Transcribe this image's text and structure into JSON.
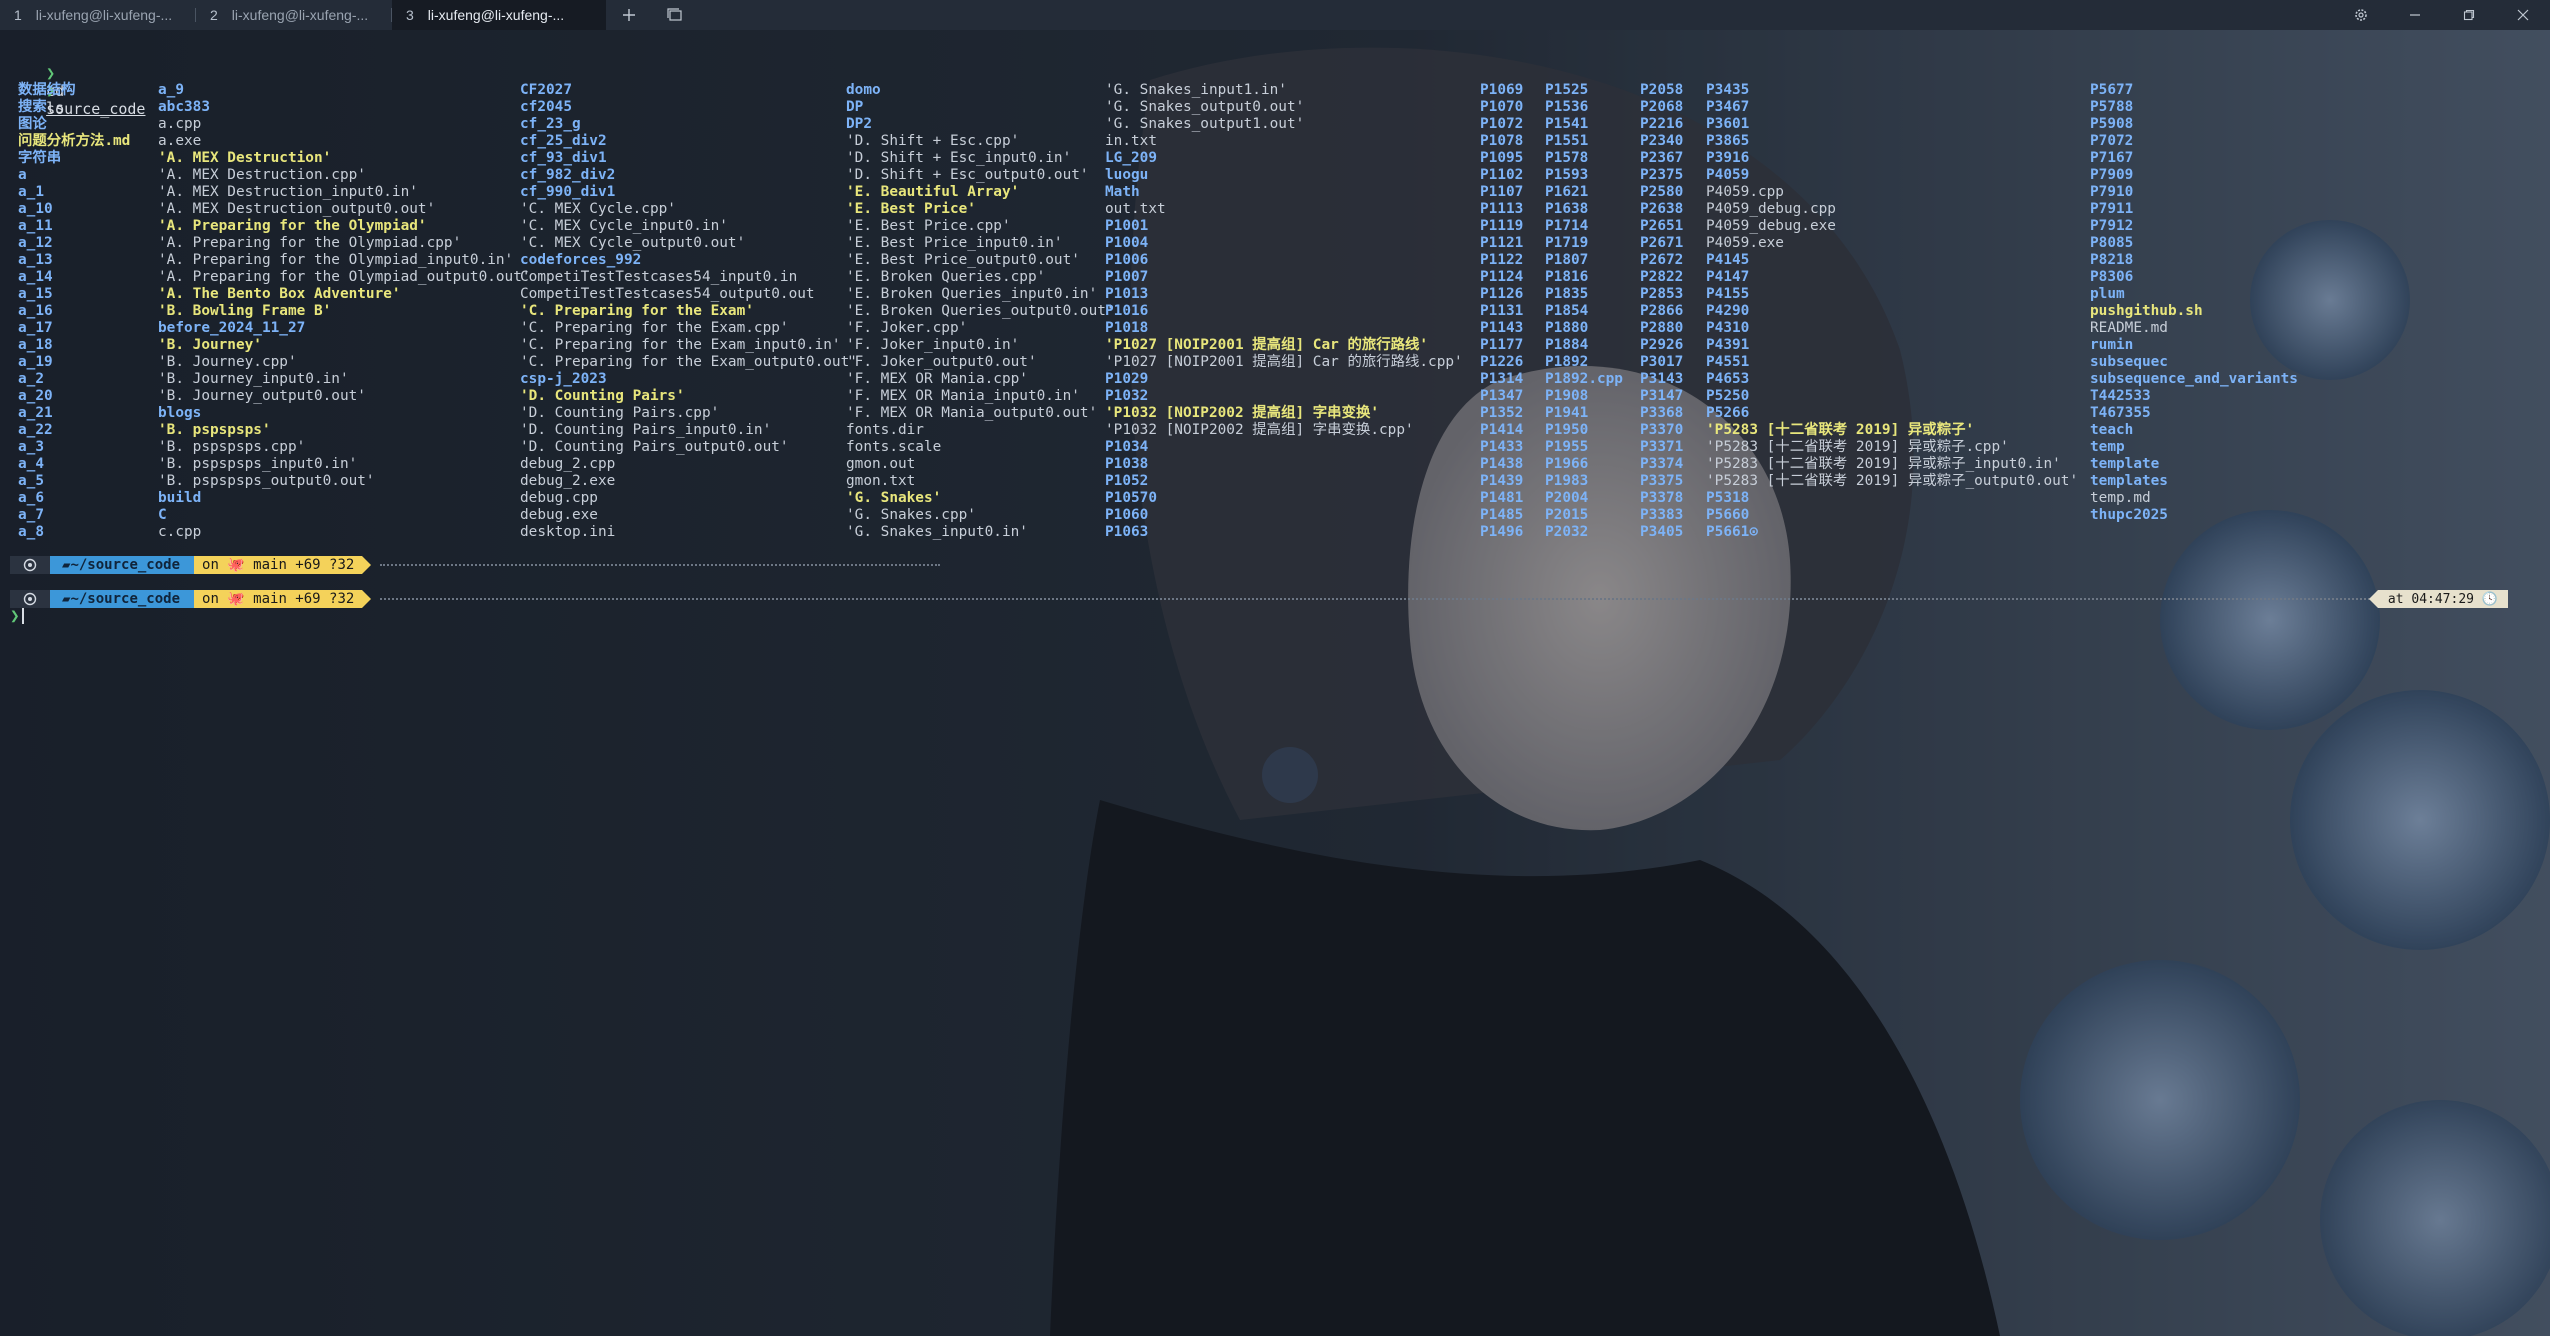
{
  "tabs": [
    {
      "num": "1",
      "label": "li-xufeng@li-xufeng-...",
      "active": false
    },
    {
      "num": "2",
      "label": "li-xufeng@li-xufeng-...",
      "active": false
    },
    {
      "num": "3",
      "label": "li-xufeng@li-xufeng-...",
      "active": true
    }
  ],
  "titlebar": {
    "new_tab_icon": "plus-icon",
    "tab_list_icon": "tab-list-icon",
    "settings_icon": "gear-icon",
    "minimize_icon": "minimize-icon",
    "maximize_icon": "maximize-icon",
    "close_icon": "close-icon"
  },
  "terminal": {
    "prompt_symbol": "❯",
    "commands": [
      {
        "cmd": "cd",
        "arg": "source_code"
      },
      {
        "cmd": "ls",
        "arg": ""
      }
    ],
    "listing_columns": [
      [
        [
          "数据结构",
          "dir"
        ],
        [
          "搜索",
          "dir"
        ],
        [
          "图论",
          "dir"
        ],
        [
          "问题分析方法.md",
          "hl"
        ],
        [
          "字符串",
          "dir"
        ],
        [
          "a",
          "dir"
        ],
        [
          "a_1",
          "dir"
        ],
        [
          "a_10",
          "dir"
        ],
        [
          "a_11",
          "dir"
        ],
        [
          "a_12",
          "dir"
        ],
        [
          "a_13",
          "dir"
        ],
        [
          "a_14",
          "dir"
        ],
        [
          "a_15",
          "dir"
        ],
        [
          "a_16",
          "dir"
        ],
        [
          "a_17",
          "dir"
        ],
        [
          "a_18",
          "dir"
        ],
        [
          "a_19",
          "dir"
        ],
        [
          "a_2",
          "dir"
        ],
        [
          "a_20",
          "dir"
        ],
        [
          "a_21",
          "dir"
        ],
        [
          "a_22",
          "dir"
        ],
        [
          "a_3",
          "dir"
        ],
        [
          "a_4",
          "dir"
        ],
        [
          "a_5",
          "dir"
        ],
        [
          "a_6",
          "dir"
        ],
        [
          "a_7",
          "dir"
        ],
        [
          "a_8",
          "dir"
        ]
      ],
      [
        [
          "a_9",
          "dir"
        ],
        [
          "abc383",
          "dir"
        ],
        [
          "a.cpp",
          "file"
        ],
        [
          "a.exe",
          "file"
        ],
        [
          "'A. MEX Destruction'",
          "hl"
        ],
        [
          "'A. MEX Destruction.cpp'",
          "file"
        ],
        [
          "'A. MEX Destruction_input0.in'",
          "file"
        ],
        [
          "'A. MEX Destruction_output0.out'",
          "file"
        ],
        [
          "'A. Preparing for the Olympiad'",
          "hl"
        ],
        [
          "'A. Preparing for the Olympiad.cpp'",
          "file"
        ],
        [
          "'A. Preparing for the Olympiad_input0.in'",
          "file"
        ],
        [
          "'A. Preparing for the Olympiad_output0.out'",
          "file"
        ],
        [
          "'A. The Bento Box Adventure'",
          "hl"
        ],
        [
          "'B. Bowling Frame B'",
          "hl"
        ],
        [
          "before_2024_11_27",
          "dir"
        ],
        [
          "'B. Journey'",
          "hl"
        ],
        [
          "'B. Journey.cpp'",
          "file"
        ],
        [
          "'B. Journey_input0.in'",
          "file"
        ],
        [
          "'B. Journey_output0.out'",
          "file"
        ],
        [
          "blogs",
          "dir"
        ],
        [
          "'B. pspspsps'",
          "hl"
        ],
        [
          "'B. pspspsps.cpp'",
          "file"
        ],
        [
          "'B. pspspsps_input0.in'",
          "file"
        ],
        [
          "'B. pspspsps_output0.out'",
          "file"
        ],
        [
          "build",
          "dir"
        ],
        [
          "C",
          "dir"
        ],
        [
          "c.cpp",
          "file"
        ]
      ],
      [
        [
          "CF2027",
          "dir"
        ],
        [
          "cf2045",
          "dir"
        ],
        [
          "cf_23_g",
          "dir"
        ],
        [
          "cf_25_div2",
          "dir"
        ],
        [
          "cf_93_div1",
          "dir"
        ],
        [
          "cf_982_div2",
          "dir"
        ],
        [
          "cf_990_div1",
          "dir"
        ],
        [
          "'C. MEX Cycle.cpp'",
          "file"
        ],
        [
          "'C. MEX Cycle_input0.in'",
          "file"
        ],
        [
          "'C. MEX Cycle_output0.out'",
          "file"
        ],
        [
          "codeforces_992",
          "dir"
        ],
        [
          "CompetiTestTestcases54_input0.in",
          "file"
        ],
        [
          "CompetiTestTestcases54_output0.out",
          "file"
        ],
        [
          "'C. Preparing for the Exam'",
          "hl"
        ],
        [
          "'C. Preparing for the Exam.cpp'",
          "file"
        ],
        [
          "'C. Preparing for the Exam_input0.in'",
          "file"
        ],
        [
          "'C. Preparing for the Exam_output0.out'",
          "file"
        ],
        [
          "csp-j_2023",
          "dir"
        ],
        [
          "'D. Counting Pairs'",
          "hl"
        ],
        [
          "'D. Counting Pairs.cpp'",
          "file"
        ],
        [
          "'D. Counting Pairs_input0.in'",
          "file"
        ],
        [
          "'D. Counting Pairs_output0.out'",
          "file"
        ],
        [
          "debug_2.cpp",
          "file"
        ],
        [
          "debug_2.exe",
          "file"
        ],
        [
          "debug.cpp",
          "file"
        ],
        [
          "debug.exe",
          "file"
        ],
        [
          "desktop.ini",
          "file"
        ]
      ],
      [
        [
          "domo",
          "dir"
        ],
        [
          "DP",
          "dir"
        ],
        [
          "DP2",
          "dir"
        ],
        [
          "'D. Shift + Esc.cpp'",
          "file"
        ],
        [
          "'D. Shift + Esc_input0.in'",
          "file"
        ],
        [
          "'D. Shift + Esc_output0.out'",
          "file"
        ],
        [
          "'E. Beautiful Array'",
          "hl"
        ],
        [
          "'E. Best Price'",
          "hl"
        ],
        [
          "'E. Best Price.cpp'",
          "file"
        ],
        [
          "'E. Best Price_input0.in'",
          "file"
        ],
        [
          "'E. Best Price_output0.out'",
          "file"
        ],
        [
          "'E. Broken Queries.cpp'",
          "file"
        ],
        [
          "'E. Broken Queries_input0.in'",
          "file"
        ],
        [
          "'E. Broken Queries_output0.out'",
          "file"
        ],
        [
          "'F. Joker.cpp'",
          "file"
        ],
        [
          "'F. Joker_input0.in'",
          "file"
        ],
        [
          "'F. Joker_output0.out'",
          "file"
        ],
        [
          "'F. MEX OR Mania.cpp'",
          "file"
        ],
        [
          "'F. MEX OR Mania_input0.in'",
          "file"
        ],
        [
          "'F. MEX OR Mania_output0.out'",
          "file"
        ],
        [
          "fonts.dir",
          "file"
        ],
        [
          "fonts.scale",
          "file"
        ],
        [
          "gmon.out",
          "file"
        ],
        [
          "gmon.txt",
          "file"
        ],
        [
          "'G. Snakes'",
          "hl"
        ],
        [
          "'G. Snakes.cpp'",
          "file"
        ],
        [
          "'G. Snakes_input0.in'",
          "file"
        ]
      ],
      [
        [
          "'G. Snakes_input1.in'",
          "file"
        ],
        [
          "'G. Snakes_output0.out'",
          "file"
        ],
        [
          "'G. Snakes_output1.out'",
          "file"
        ],
        [
          "in.txt",
          "file"
        ],
        [
          "LG_209",
          "dir"
        ],
        [
          "luogu",
          "dir"
        ],
        [
          "Math",
          "dir"
        ],
        [
          "out.txt",
          "file"
        ],
        [
          "P1001",
          "dir"
        ],
        [
          "P1004",
          "dir"
        ],
        [
          "P1006",
          "dir"
        ],
        [
          "P1007",
          "dir"
        ],
        [
          "P1013",
          "dir"
        ],
        [
          "P1016",
          "dir"
        ],
        [
          "P1018",
          "dir"
        ],
        [
          "'P1027 [NOIP2001 提高组] Car 的旅行路线'",
          "hl"
        ],
        [
          "'P1027 [NOIP2001 提高组] Car 的旅行路线.cpp'",
          "file"
        ],
        [
          "P1029",
          "dir"
        ],
        [
          "P1032",
          "dir"
        ],
        [
          "'P1032 [NOIP2002 提高组] 字串变换'",
          "hl"
        ],
        [
          "'P1032 [NOIP2002 提高组] 字串变换.cpp'",
          "file"
        ],
        [
          "P1034",
          "dir"
        ],
        [
          "P1038",
          "dir"
        ],
        [
          "P1052",
          "dir"
        ],
        [
          "P10570",
          "dir"
        ],
        [
          "P1060",
          "dir"
        ],
        [
          "P1063",
          "dir"
        ]
      ],
      [
        [
          "P1069",
          "dir"
        ],
        [
          "P1070",
          "dir"
        ],
        [
          "P1072",
          "dir"
        ],
        [
          "P1078",
          "dir"
        ],
        [
          "P1095",
          "dir"
        ],
        [
          "P1102",
          "dir"
        ],
        [
          "P1107",
          "dir"
        ],
        [
          "P1113",
          "dir"
        ],
        [
          "P1119",
          "dir"
        ],
        [
          "P1121",
          "dir"
        ],
        [
          "P1122",
          "dir"
        ],
        [
          "P1124",
          "dir"
        ],
        [
          "P1126",
          "dir"
        ],
        [
          "P1131",
          "dir"
        ],
        [
          "P1143",
          "dir"
        ],
        [
          "P1177",
          "dir"
        ],
        [
          "P1226",
          "dir"
        ],
        [
          "P1314",
          "dir"
        ],
        [
          "P1347",
          "dir"
        ],
        [
          "P1352",
          "dir"
        ],
        [
          "P1414",
          "dir"
        ],
        [
          "P1433",
          "dir"
        ],
        [
          "P1438",
          "dir"
        ],
        [
          "P1439",
          "dir"
        ],
        [
          "P1481",
          "dir"
        ],
        [
          "P1485",
          "dir"
        ],
        [
          "P1496",
          "dir"
        ]
      ],
      [
        [
          "P1525",
          "dir"
        ],
        [
          "P1536",
          "dir"
        ],
        [
          "P1541",
          "dir"
        ],
        [
          "P1551",
          "dir"
        ],
        [
          "P1578",
          "dir"
        ],
        [
          "P1593",
          "dir"
        ],
        [
          "P1621",
          "dir"
        ],
        [
          "P1638",
          "dir"
        ],
        [
          "P1714",
          "dir"
        ],
        [
          "P1719",
          "dir"
        ],
        [
          "P1807",
          "dir"
        ],
        [
          "P1816",
          "dir"
        ],
        [
          "P1835",
          "dir"
        ],
        [
          "P1854",
          "dir"
        ],
        [
          "P1880",
          "dir"
        ],
        [
          "P1884",
          "dir"
        ],
        [
          "P1892",
          "dir"
        ],
        [
          "P1892.cpp",
          "dir"
        ],
        [
          "P1908",
          "dir"
        ],
        [
          "P1941",
          "dir"
        ],
        [
          "P1950",
          "dir"
        ],
        [
          "P1955",
          "dir"
        ],
        [
          "P1966",
          "dir"
        ],
        [
          "P1983",
          "dir"
        ],
        [
          "P2004",
          "dir"
        ],
        [
          "P2015",
          "dir"
        ],
        [
          "P2032",
          "dir"
        ]
      ],
      [
        [
          "P2058",
          "dir"
        ],
        [
          "P2068",
          "dir"
        ],
        [
          "P2216",
          "dir"
        ],
        [
          "P2340",
          "dir"
        ],
        [
          "P2367",
          "dir"
        ],
        [
          "P2375",
          "dir"
        ],
        [
          "P2580",
          "dir"
        ],
        [
          "P2638",
          "dir"
        ],
        [
          "P2651",
          "dir"
        ],
        [
          "P2671",
          "dir"
        ],
        [
          "P2672",
          "dir"
        ],
        [
          "P2822",
          "dir"
        ],
        [
          "P2853",
          "dir"
        ],
        [
          "P2866",
          "dir"
        ],
        [
          "P2880",
          "dir"
        ],
        [
          "P2926",
          "dir"
        ],
        [
          "P3017",
          "dir"
        ],
        [
          "P3143",
          "dir"
        ],
        [
          "P3147",
          "dir"
        ],
        [
          "P3368",
          "dir"
        ],
        [
          "P3370",
          "dir"
        ],
        [
          "P3371",
          "dir"
        ],
        [
          "P3374",
          "dir"
        ],
        [
          "P3375",
          "dir"
        ],
        [
          "P3378",
          "dir"
        ],
        [
          "P3383",
          "dir"
        ],
        [
          "P3405",
          "dir"
        ]
      ],
      [
        [
          "P3435",
          "dir"
        ],
        [
          "P3467",
          "dir"
        ],
        [
          "P3601",
          "dir"
        ],
        [
          "P3865",
          "dir"
        ],
        [
          "P3916",
          "dir"
        ],
        [
          "P4059",
          "dir"
        ],
        [
          "P4059.cpp",
          "file"
        ],
        [
          "P4059_debug.cpp",
          "file"
        ],
        [
          "P4059_debug.exe",
          "file"
        ],
        [
          "P4059.exe",
          "file"
        ],
        [
          "P4145",
          "dir"
        ],
        [
          "P4147",
          "dir"
        ],
        [
          "P4155",
          "dir"
        ],
        [
          "P4290",
          "dir"
        ],
        [
          "P4310",
          "dir"
        ],
        [
          "P4391",
          "dir"
        ],
        [
          "P4551",
          "dir"
        ],
        [
          "P4653",
          "dir"
        ],
        [
          "P5250",
          "dir"
        ],
        [
          "P5266",
          "dir"
        ],
        [
          "'P5283 [十二省联考 2019] 异或粽子'",
          "hl"
        ],
        [
          "'P5283 [十二省联考 2019] 异或粽子.cpp'",
          "file"
        ],
        [
          "'P5283 [十二省联考 2019] 异或粽子_input0.in'",
          "file"
        ],
        [
          "'P5283 [十二省联考 2019] 异或粽子_output0.out'",
          "file"
        ],
        [
          "P5318",
          "dir"
        ],
        [
          "P5660",
          "dir"
        ],
        [
          "P5661⊙",
          "dir"
        ]
      ],
      [
        [
          "P5677",
          "dir"
        ],
        [
          "P5788",
          "dir"
        ],
        [
          "P5908",
          "dir"
        ],
        [
          "P7072",
          "dir"
        ],
        [
          "P7167",
          "dir"
        ],
        [
          "P7909",
          "dir"
        ],
        [
          "P7910",
          "dir"
        ],
        [
          "P7911",
          "dir"
        ],
        [
          "P7912",
          "dir"
        ],
        [
          "P8085",
          "dir"
        ],
        [
          "P8218",
          "dir"
        ],
        [
          "P8306",
          "dir"
        ],
        [
          "plum",
          "dir"
        ],
        [
          "pushgithub.sh",
          "hl"
        ],
        [
          "README.md",
          "file"
        ],
        [
          "rumin",
          "dir"
        ],
        [
          "subsequec",
          "dir"
        ],
        [
          "subsequence_and_variants",
          "dir"
        ],
        [
          "T442533",
          "dir"
        ],
        [
          "T467355",
          "dir"
        ],
        [
          "teach",
          "dir"
        ],
        [
          "temp",
          "dir"
        ],
        [
          "template",
          "dir"
        ],
        [
          "templates",
          "dir"
        ],
        [
          "temp.md",
          "file"
        ],
        [
          "thupc2025",
          "dir"
        ]
      ]
    ],
    "prompts": [
      {
        "icon": "linux-icon",
        "path": "~/source_code",
        "git": "on 🐙 main +69 ?32",
        "time": ""
      },
      {
        "icon": "linux-icon",
        "path": "~/source_code",
        "git": "on 🐙 main +69 ?32",
        "time": "at 04:47:29 🕓"
      }
    ]
  }
}
